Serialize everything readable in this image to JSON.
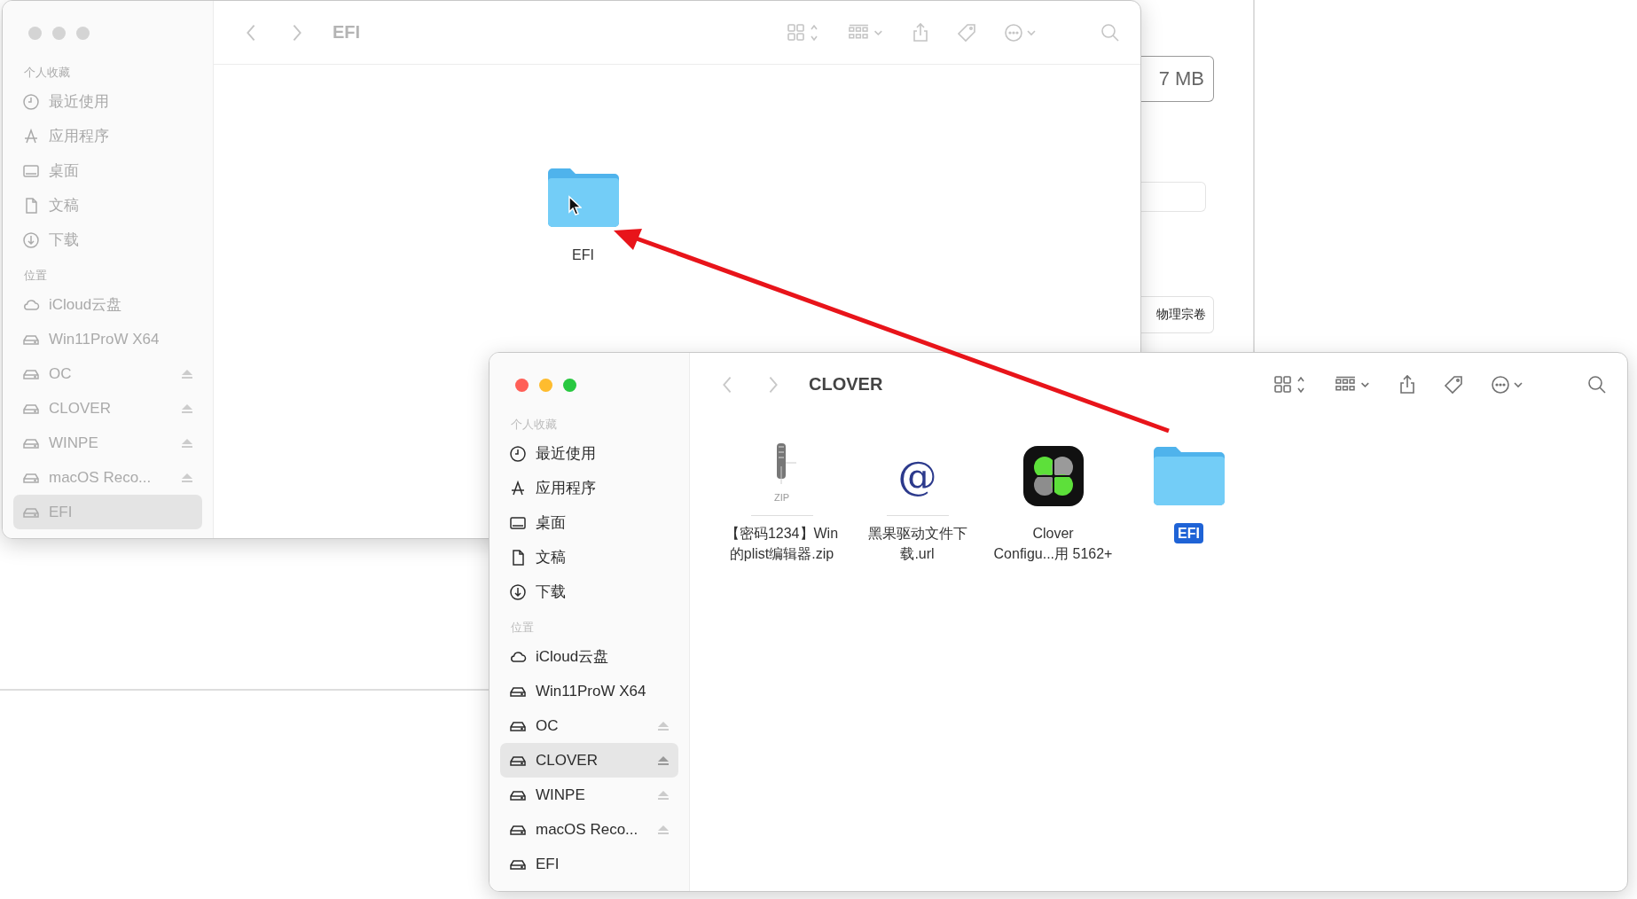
{
  "background_window": {
    "size_field": "7 MB",
    "button": "物理宗卷"
  },
  "finder_windows": [
    {
      "title": "EFI",
      "active": false,
      "sidebar": [
        {
          "heading": "个人收藏",
          "items": [
            {
              "label": "最近使用",
              "kind": "recent",
              "eject": false,
              "selected": false
            },
            {
              "label": "应用程序",
              "kind": "apps",
              "eject": false,
              "selected": false
            },
            {
              "label": "桌面",
              "kind": "desktop",
              "eject": false,
              "selected": false
            },
            {
              "label": "文稿",
              "kind": "docs",
              "eject": false,
              "selected": false
            },
            {
              "label": "下载",
              "kind": "downloads",
              "eject": false,
              "selected": false
            }
          ]
        },
        {
          "heading": "位置",
          "items": [
            {
              "label": "iCloud云盘",
              "kind": "cloud",
              "eject": false,
              "selected": false
            },
            {
              "label": "Win11ProW X64",
              "kind": "drive",
              "eject": false,
              "selected": false
            },
            {
              "label": "OC",
              "kind": "drive",
              "eject": true,
              "selected": false
            },
            {
              "label": "CLOVER",
              "kind": "drive",
              "eject": true,
              "selected": false
            },
            {
              "label": "WINPE",
              "kind": "drive",
              "eject": true,
              "selected": false
            },
            {
              "label": "macOS Reco...",
              "kind": "drive",
              "eject": true,
              "selected": false
            },
            {
              "label": "EFI",
              "kind": "drive",
              "eject": false,
              "selected": true
            }
          ]
        }
      ],
      "files": [
        {
          "name_lines": [
            "EFI"
          ],
          "kind": "folder",
          "selected": false
        }
      ]
    },
    {
      "title": "CLOVER",
      "active": true,
      "sidebar": [
        {
          "heading": "个人收藏",
          "items": [
            {
              "label": "最近使用",
              "kind": "recent",
              "eject": false,
              "selected": false
            },
            {
              "label": "应用程序",
              "kind": "apps",
              "eject": false,
              "selected": false
            },
            {
              "label": "桌面",
              "kind": "desktop",
              "eject": false,
              "selected": false
            },
            {
              "label": "文稿",
              "kind": "docs",
              "eject": false,
              "selected": false
            },
            {
              "label": "下载",
              "kind": "downloads",
              "eject": false,
              "selected": false
            }
          ]
        },
        {
          "heading": "位置",
          "items": [
            {
              "label": "iCloud云盘",
              "kind": "cloud",
              "eject": false,
              "selected": false
            },
            {
              "label": "Win11ProW X64",
              "kind": "drive",
              "eject": false,
              "selected": false
            },
            {
              "label": "OC",
              "kind": "drive",
              "eject": true,
              "selected": false
            },
            {
              "label": "CLOVER",
              "kind": "drive",
              "eject": true,
              "selected": true
            },
            {
              "label": "WINPE",
              "kind": "drive",
              "eject": true,
              "selected": false
            },
            {
              "label": "macOS Reco...",
              "kind": "drive",
              "eject": true,
              "selected": false
            },
            {
              "label": "EFI",
              "kind": "drive",
              "eject": false,
              "selected": false
            }
          ]
        }
      ],
      "files": [
        {
          "name_lines": [
            "【密码1234】Win",
            "的plist编辑器.zip"
          ],
          "kind": "zip",
          "badge": "ZIP",
          "selected": false
        },
        {
          "name_lines": [
            "黑果驱动文件下",
            "载.url"
          ],
          "kind": "url",
          "glyph": "@",
          "selected": false
        },
        {
          "name_lines": [
            "Clover",
            "Configu...用 5162+"
          ],
          "kind": "app",
          "selected": false
        },
        {
          "name_lines": [
            "EFI"
          ],
          "kind": "folder",
          "selected": true
        }
      ]
    }
  ]
}
